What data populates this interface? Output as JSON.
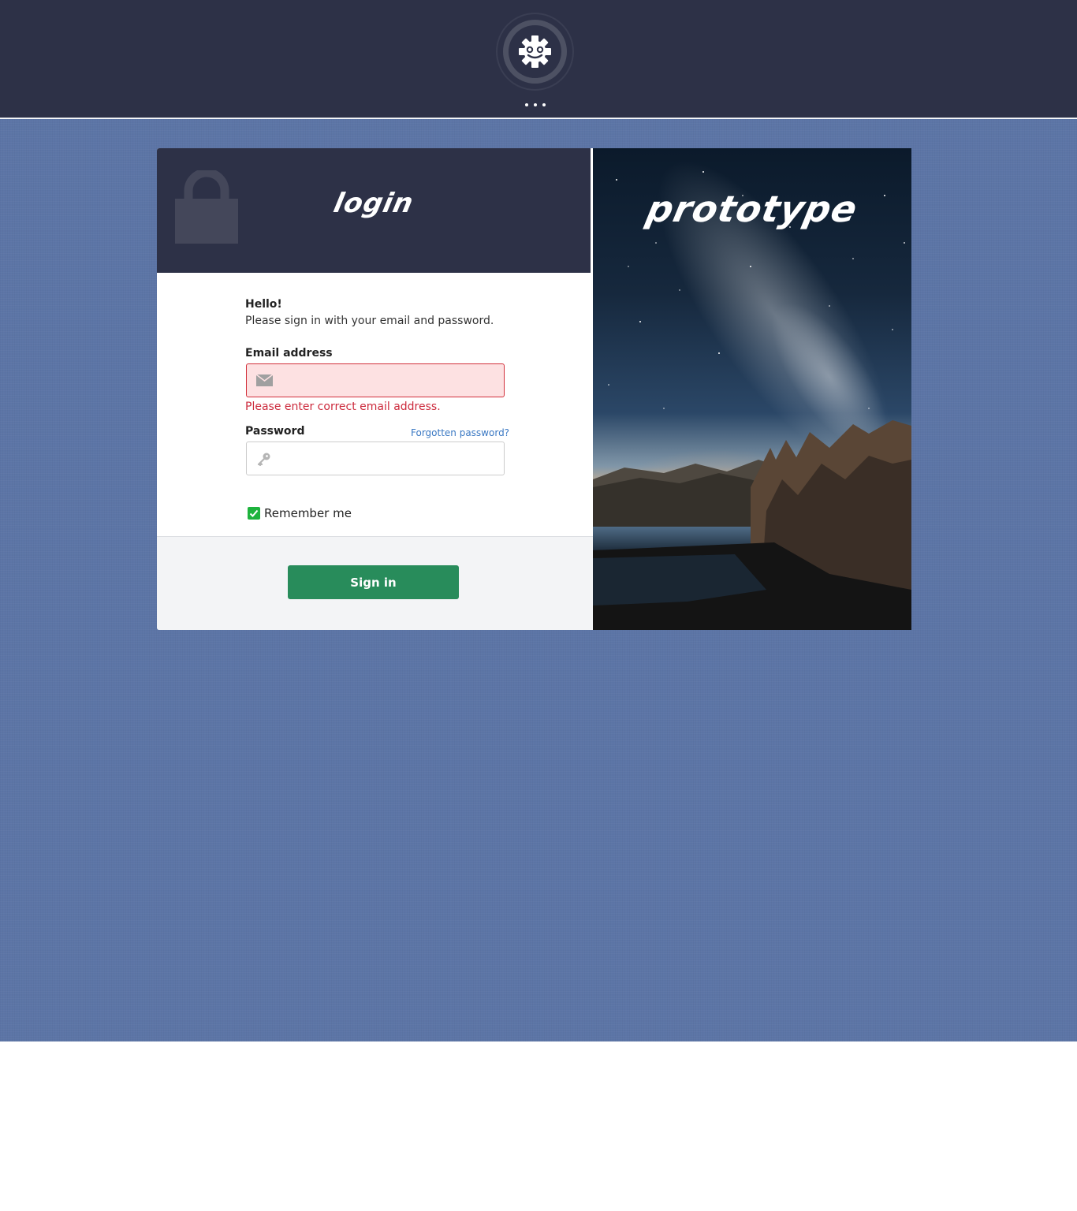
{
  "header": {
    "logo_icon": "robot-gear-icon",
    "menu_icon": "ellipsis-icon"
  },
  "login_panel": {
    "title": "login",
    "lock_icon": "padlock-icon",
    "greeting": "Hello!",
    "instructions": "Please sign in with your email and password.",
    "email": {
      "label": "Email address",
      "value": "",
      "placeholder": "",
      "icon": "envelope-icon",
      "error": "Please enter correct email address."
    },
    "password": {
      "label": "Password",
      "value": "",
      "placeholder": "",
      "icon": "key-icon",
      "forgot_link": "Forgotten password?"
    },
    "remember_me": {
      "label": "Remember me",
      "checked": true
    },
    "submit_label": "Sign in"
  },
  "hero": {
    "title": "prototype"
  },
  "colors": {
    "header_bg": "#2d3147",
    "page_bg": "#5c75a6",
    "error": "#cc2a3c",
    "error_field_bg": "#fde1e2",
    "button": "#288c5b",
    "checkbox": "#1eb33d",
    "link": "#3a78c3"
  }
}
